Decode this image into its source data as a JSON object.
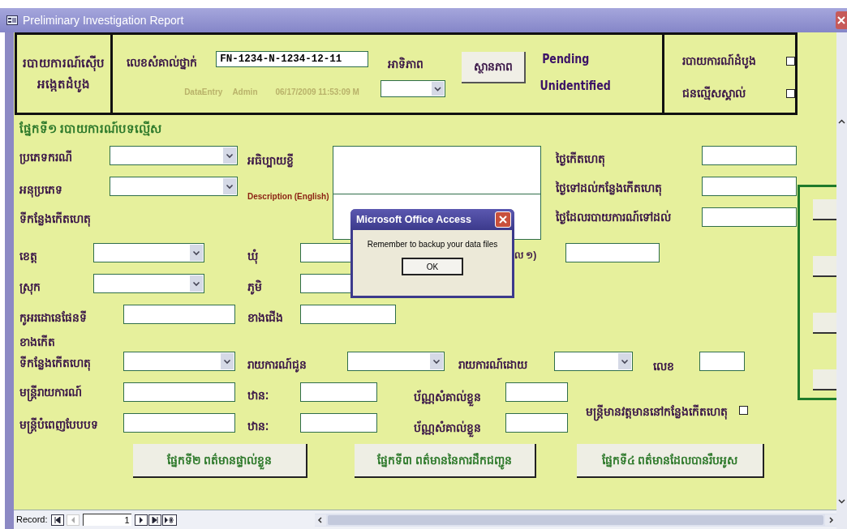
{
  "window": {
    "title": "Preliminary Investigation Report"
  },
  "header": {
    "form_title": [
      "របាយការណ៍ស៊ើប",
      "អង្កេតដំបូង"
    ],
    "file_number_label": "លេខសំគាល់ថ្នាក់",
    "file_number": "FN-1234-N-1234-12-11",
    "entry_role": "DataEntry",
    "user": "Admin",
    "timestamp": "06/17/2009 11:53:09 M",
    "priority_label": "អាទិភាព",
    "status_button": "ស្ថានភាព",
    "status": "Pending",
    "identity": "Unidentified",
    "checkboxes": [
      {
        "label": "របាយការណ៍ដំបូង",
        "checked": false
      },
      {
        "label": "ជនល្មើសស្គាល់",
        "checked": false
      }
    ]
  },
  "section_1": {
    "title": "ផ្នែកទី១ របាយការណ៍បទល្មើស",
    "case_type": "ប្រភេទករណី",
    "subtype": "អនុប្រភេទ",
    "place_heading": "ទីកន្លែងកើតហេតុ",
    "short_description": "អធិប្បាយខ្លី",
    "description_english": "Description (English)",
    "incident_date": "ថ្ងៃកើតហេតុ",
    "arrival_date": "ថ្ងៃទៅដល់កន្លែងកើតហេតុ",
    "report_date": "ថ្ងៃដែលរបាយការណ៍ទៅដល់",
    "province": "ខេត្ត",
    "commune": "ឃុំ",
    "partial_label": "ល ១)",
    "district": "ស្រុក",
    "village": "ភូមិ",
    "map_coordinates": "កូអរដោនេផែនទី",
    "north": "ខាងជើង",
    "east": "ខាងកើត",
    "place": "ទីកន្លែងកើតហេតុ",
    "report_to": "រាយការណ៍ជូន",
    "report_by": "រាយការណ៍ដោយ",
    "number": "លេខ",
    "reporting_officer": "មន្ត្រីរាយការណ៍",
    "rank_1": "ឋានៈ",
    "id_card_1": "ប័ណ្ណសំគាល់ខ្លួន",
    "form_officer": "មន្ត្រីបំពេញបែបបទ",
    "rank_2": "ឋានៈ",
    "id_card_2": "ប័ណ្ណសំគាល់ខ្លួន",
    "officer_present": {
      "label": "មន្ត្រីមានវត្តមាននៅកន្លែងកើតហេតុ",
      "checked": false
    }
  },
  "section_buttons": [
    "ផ្នែកទី២ ពត៌មានផ្ទាល់ខ្លួន",
    "ផ្នែកទី៣ ពត៌មាននៃការដឹកជញ្ជូន",
    "ផ្នែកទី៤ ពត៌មានដែលបានរឹបអូស"
  ],
  "dialog": {
    "title": "Microsoft Office Access",
    "message": "Remember to backup your data files",
    "button": "OK"
  },
  "record_nav": {
    "label": "Record:",
    "current": "1"
  }
}
